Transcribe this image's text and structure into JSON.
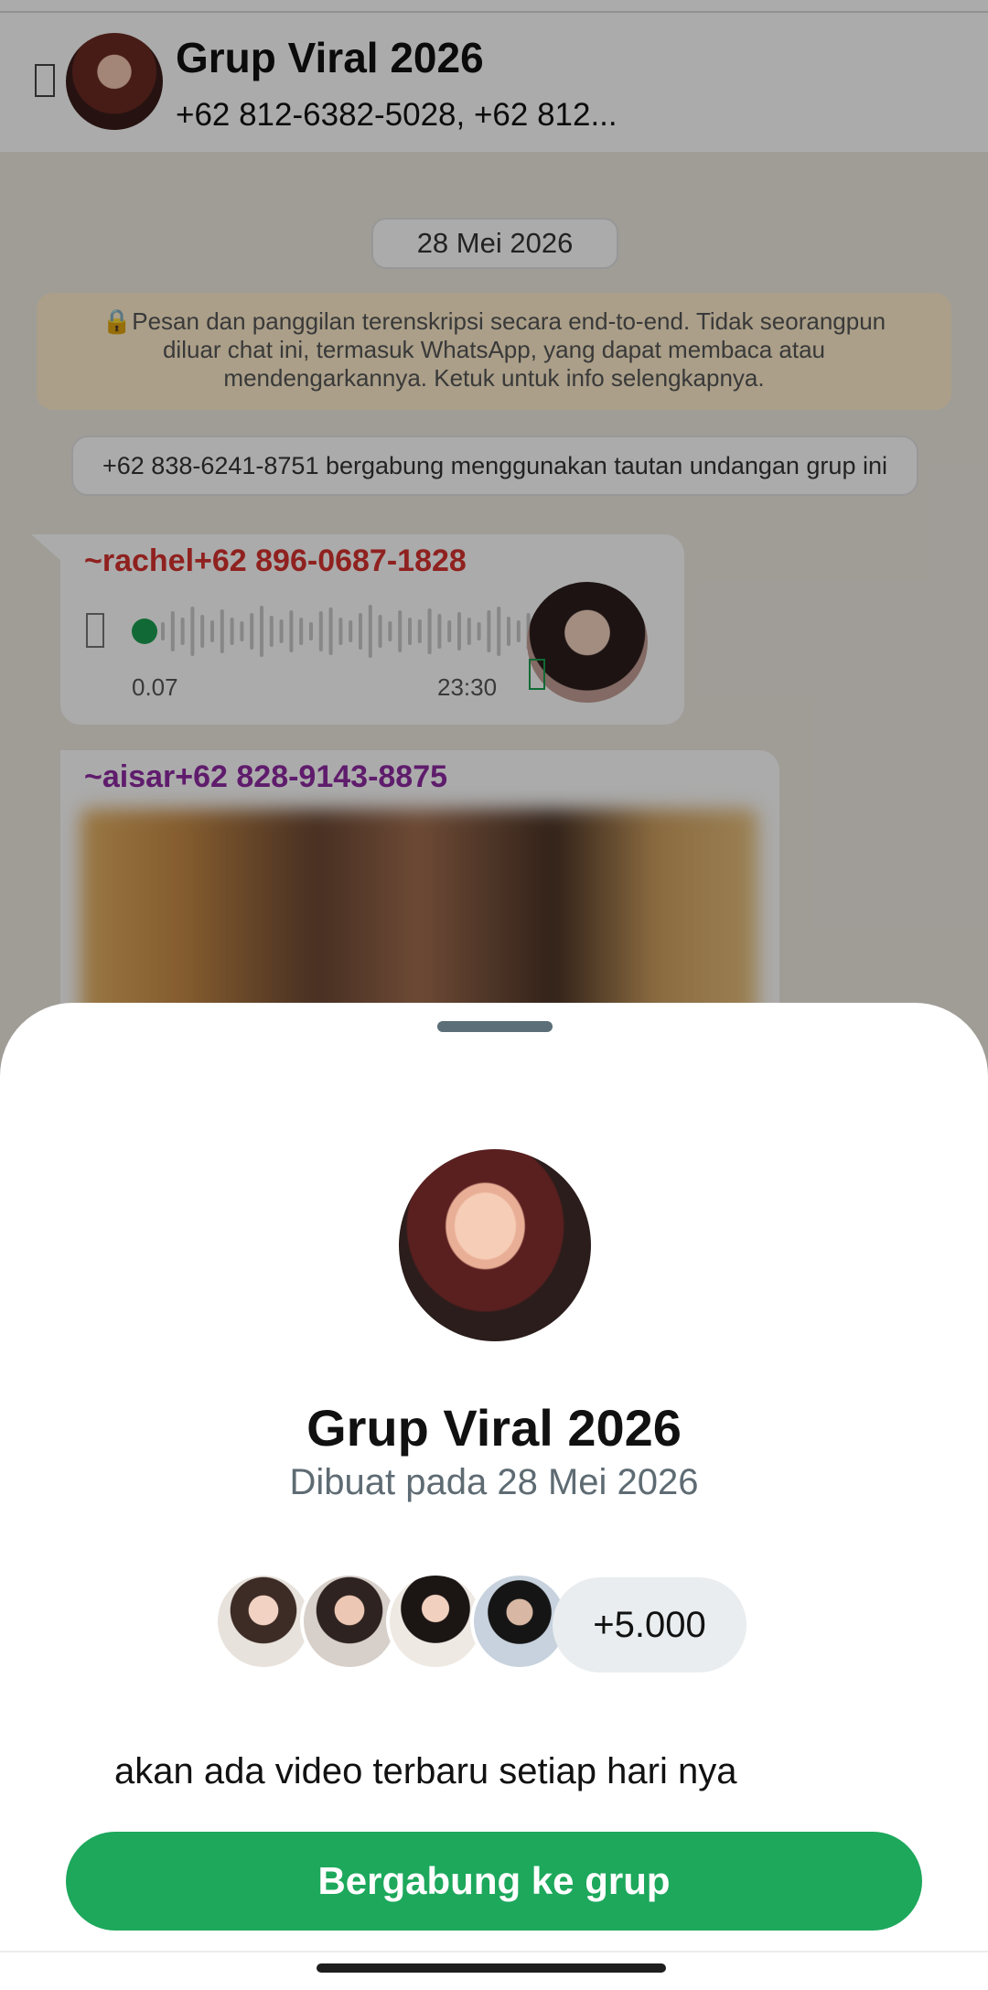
{
  "header": {
    "title": "Grup Viral 2026",
    "subtitle": "+62 812-6382-5028, +62 812..."
  },
  "chat": {
    "date_chip": "28 Mei 2026",
    "encryption_note": "🔒Pesan dan panggilan terenskripsi secara end-to-end. Tidak seorangpun diluar chat ini, termasuk WhatsApp, yang dapat membaca atau mendengarkannya. Ketuk untuk info selengkapnya.",
    "join_notice": "+62 838-6241-8751 bergabung menggunakan tautan undangan grup ini",
    "voice_message": {
      "sender": "~rachel+62 896-0687-1828",
      "elapsed": "0.07",
      "time": "23:30"
    },
    "image_message": {
      "sender": "~aisar+62 828-9143-8875"
    }
  },
  "sheet": {
    "title": "Grup Viral 2026",
    "subtitle": "Dibuat pada 28 Mei 2026",
    "member_count": "+5.000",
    "description": "akan ada video terbaru setiap hari nya",
    "join_button": "Bergabung ke grup"
  },
  "colors": {
    "accent": "#1da85c",
    "sender_red": "#d5322f",
    "sender_purple": "#8e2aa2"
  }
}
